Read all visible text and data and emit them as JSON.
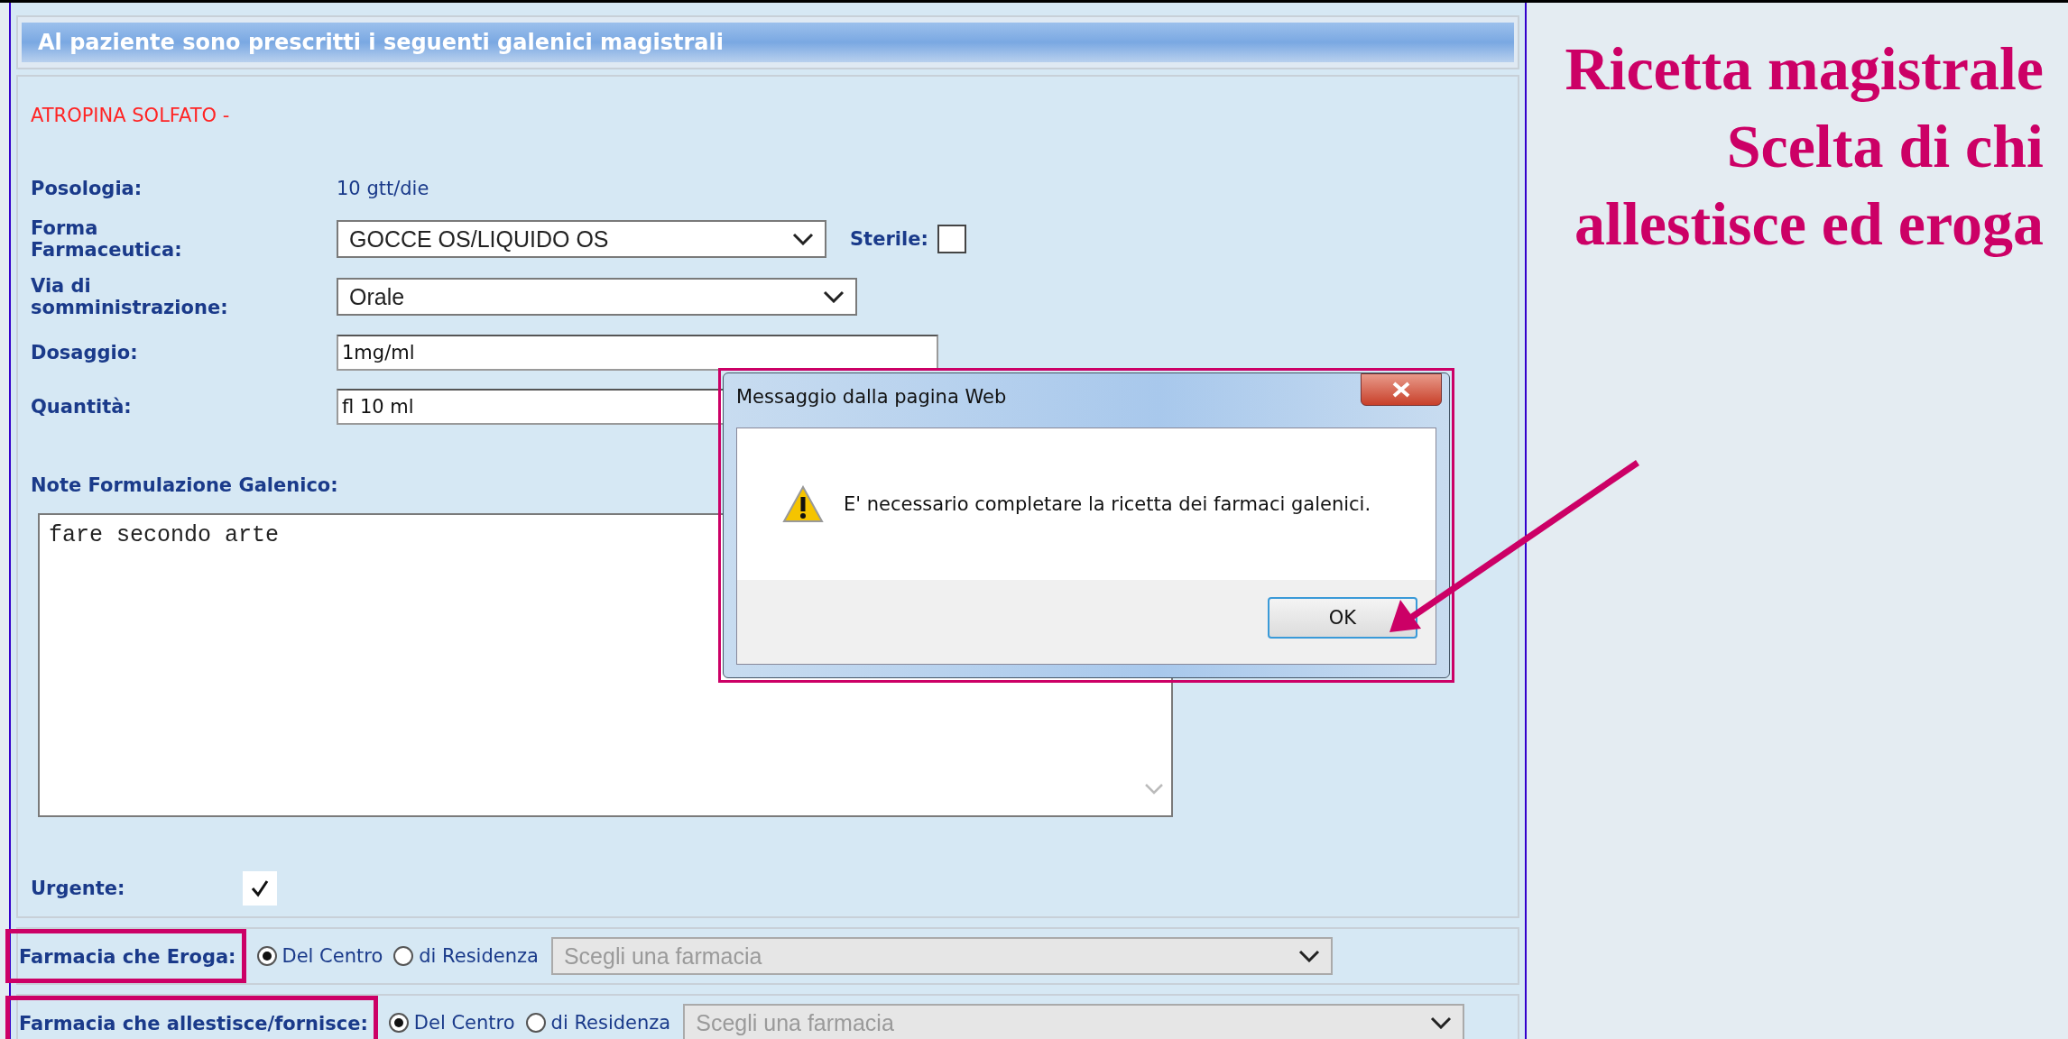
{
  "panel": {
    "title": "Al paziente sono prescritti i seguenti galenici magistrali"
  },
  "drug": "ATROPINA SOLFATO -",
  "fields": [
    {
      "kind": "text",
      "label": "Posologia:",
      "value": "10 gtt/die"
    },
    {
      "kind": "select",
      "label": "Forma Farmaceutica:",
      "value": "GOCCE OS/LIQUIDO OS",
      "extra": {
        "label": "Sterile:",
        "checked": false
      }
    },
    {
      "kind": "select",
      "label": "Via di somministrazione:",
      "value": "Orale"
    },
    {
      "kind": "input",
      "label": "Dosaggio:",
      "value": "1mg/ml"
    },
    {
      "kind": "input",
      "label": "Quantità:",
      "value": "fl 10 ml"
    }
  ],
  "notes": {
    "label": "Note Formulazione Galenico:",
    "value": "fare secondo arte"
  },
  "urgent": {
    "label": "Urgente:",
    "checked": true
  },
  "pharmacy_rows": [
    {
      "label": "Farmacia che Eroga:",
      "highlighted": true,
      "options": [
        {
          "label": "Del Centro",
          "selected": true
        },
        {
          "label": "di Residenza",
          "selected": false
        }
      ],
      "select": {
        "placeholder": "Scegli una farmacia",
        "disabled": true
      }
    },
    {
      "label": "Farmacia che allestisce/fornisce:",
      "highlighted": true,
      "options": [
        {
          "label": "Del Centro",
          "selected": true
        },
        {
          "label": "di Residenza",
          "selected": false
        }
      ],
      "select": {
        "placeholder": "Scegli una farmacia",
        "disabled": true
      }
    }
  ],
  "dialog": {
    "title": "Messaggio dalla pagina Web",
    "message": "E' necessario completare la ricetta dei farmaci galenici.",
    "buttons": [
      "OK"
    ]
  },
  "slide_title": [
    "Ricetta magistrale",
    "Scelta di chi",
    "allestisce ed eroga"
  ]
}
